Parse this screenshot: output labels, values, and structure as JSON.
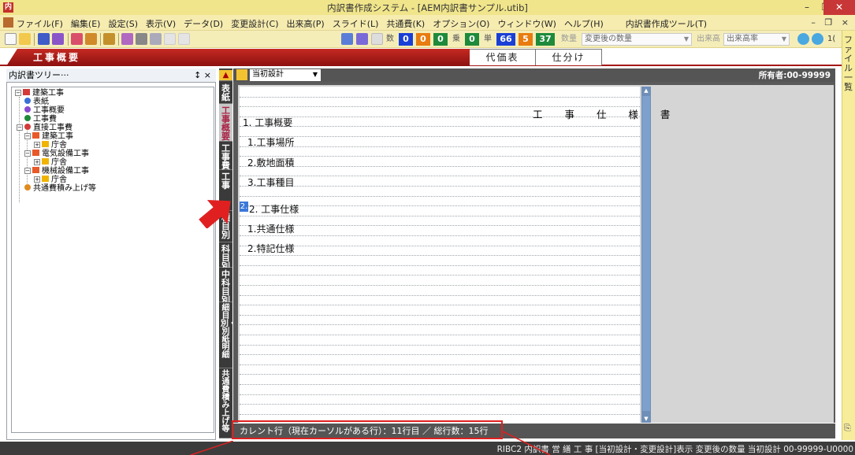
{
  "window": {
    "app_icon": "内",
    "title": "内訳書作成システム - [AEM内訳書サンプル.utib]",
    "minimize": "–",
    "maximize": "❐",
    "close": "✕"
  },
  "menu": {
    "items": [
      "ファイル(F)",
      "編集(E)",
      "設定(S)",
      "表示(V)",
      "データ(D)",
      "変更設計(C)",
      "出来高(P)",
      "スライド(L)",
      "共通費(K)",
      "オプション(O)",
      "ウィンドウ(W)",
      "ヘルプ(H)",
      "内訳書作成ツール(T)"
    ],
    "mdi_controls": "– ❐ ×"
  },
  "toolbar": {
    "counts": [
      {
        "label": "数",
        "value": "0",
        "color": "#1a3fd6"
      },
      {
        "value": "0",
        "color": "#e87c10"
      },
      {
        "value": "0",
        "color": "#1e8a3a"
      },
      {
        "label": "乗",
        "value": "0",
        "color": "#1e8a3a"
      },
      {
        "label": "単",
        "value": "66",
        "color": "#1a3fd6"
      },
      {
        "value": "5",
        "color": "#e87c10"
      },
      {
        "value": "37",
        "color": "#1e8a3a"
      }
    ],
    "qty_label": "数量",
    "qty_combo": "変更後の数量",
    "progress_label": "出来高",
    "progress_combo": "出来高率",
    "tail_text": "1("
  },
  "tabs": {
    "active": "工事概要",
    "others": [
      "代価表",
      "仕分け"
    ]
  },
  "right_strip": {
    "label": "ファイル一覧"
  },
  "tree_panel": {
    "title": "内訳書ツリー···",
    "controls": "↕ ×",
    "nodes": [
      {
        "label": "建築工事"
      },
      {
        "label": "表紙"
      },
      {
        "label": "工事概要"
      },
      {
        "label": "工事費"
      },
      {
        "label": "直接工事費"
      },
      {
        "label": "建築工事"
      },
      {
        "label": "庁舎"
      },
      {
        "label": "電気設備工事"
      },
      {
        "label": "庁舎"
      },
      {
        "label": "機械設備工事"
      },
      {
        "label": "庁舎"
      },
      {
        "label": "共通費積み上げ等"
      }
    ]
  },
  "vertical_tabs": [
    "表紙",
    "工事概要",
    "工事費",
    "工事",
    "種目別",
    "科目別",
    "中科目別",
    "細目別・別紙明細",
    "共通費積み上げ等"
  ],
  "doc_toolbar": {
    "design_select": "当初設計",
    "owner": "所有者:00-99999"
  },
  "document": {
    "title": "工 事 仕 様 書",
    "lines": [
      "1. 工事概要",
      "1.工事場所",
      "2.敷地面積",
      "3.工事種目",
      "2. 工事仕様",
      "1.共通仕様",
      "2.特記仕様"
    ],
    "current_marker": "2."
  },
  "doc_status": "カレント行（現在カーソルがある行）：11行目 ／ 総行数：15行",
  "status_bar": "RIBC2 内訳書 営 繕 工 事 [当初設計・変更設計]表示 変更後の数量 当初設計 00-99999-U0000"
}
